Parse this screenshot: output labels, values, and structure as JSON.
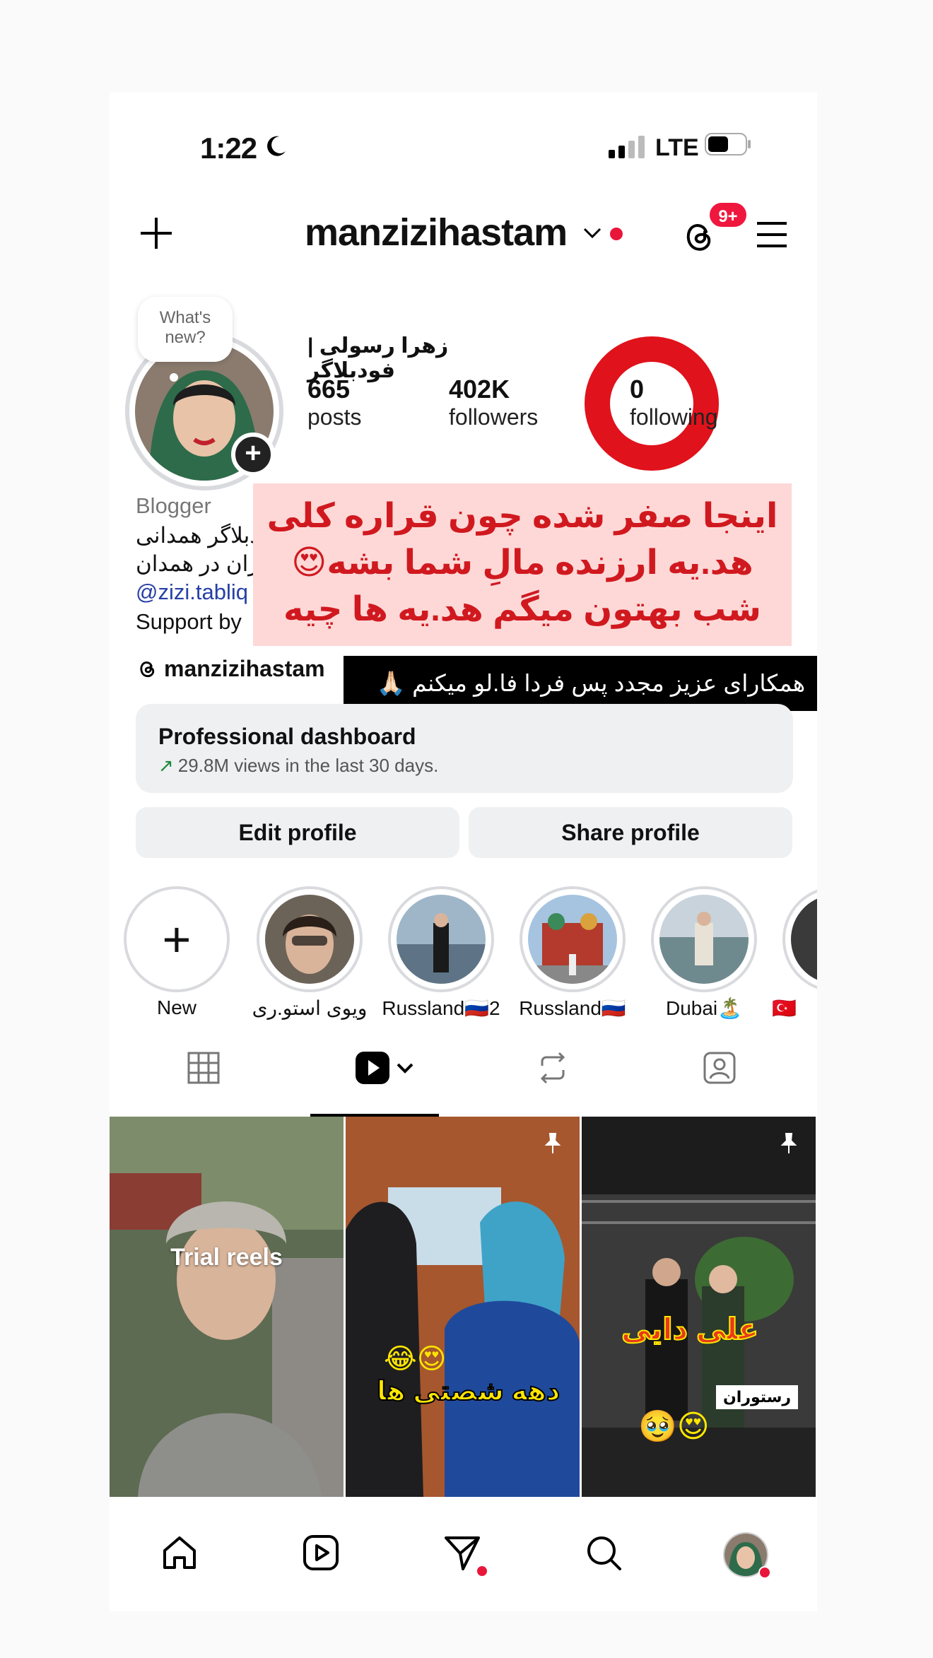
{
  "status": {
    "time": "1:22",
    "network": "LTE"
  },
  "header": {
    "username": "manzizihastam",
    "notif_badge": "9+"
  },
  "profile": {
    "avatar_bubble": "What's new?",
    "full_name": "زهرا رسولی | فودبلاگر",
    "stats": {
      "posts_count": "665",
      "posts_label": "posts",
      "followers_count": "402K",
      "followers_label": "followers",
      "following_count": "0",
      "following_label": "following"
    },
    "category": "Blogger",
    "bio_line1": "فودبلاگر همدانی",
    "bio_line2": "معرفی رستوران در همدان",
    "bio_link": "@zizi.tabliq",
    "bio_support": "Support by",
    "threads_handle": "manzizihastam"
  },
  "overlays": {
    "pink_note": "اینجا صفر شده چون قراره کلی هد.یه ارزنده مالِ شما بشه😍 شب بهتون میگم هد.یه ها چیه",
    "black_note": "همکارای عزیز مجدد پس فردا فا.لو میکنم 🙏🏻"
  },
  "dashboard": {
    "title": "Professional dashboard",
    "subtitle": "29.8M views in the last 30 days."
  },
  "buttons": {
    "edit": "Edit profile",
    "share": "Share profile"
  },
  "highlights": [
    {
      "label": "New"
    },
    {
      "label": "ویوی استو.ری"
    },
    {
      "label": "Russland🇷🇺2"
    },
    {
      "label": "Russland🇷🇺"
    },
    {
      "label": "Dubai🏝️"
    },
    {
      "label": "🇹🇷"
    }
  ],
  "grid": {
    "cell1_label": "Trial reels",
    "cell2_overlay": "دهه شصتی ها",
    "cell2_emoji": "😍😂",
    "cell3_overlay": "علی دایی",
    "cell3_tag": "رستوران",
    "cell3_emoji": "😍🥹"
  },
  "colors": {
    "notification_red": "#e8173a",
    "annotation_red": "#e0121b",
    "link_blue": "#2740a6"
  }
}
